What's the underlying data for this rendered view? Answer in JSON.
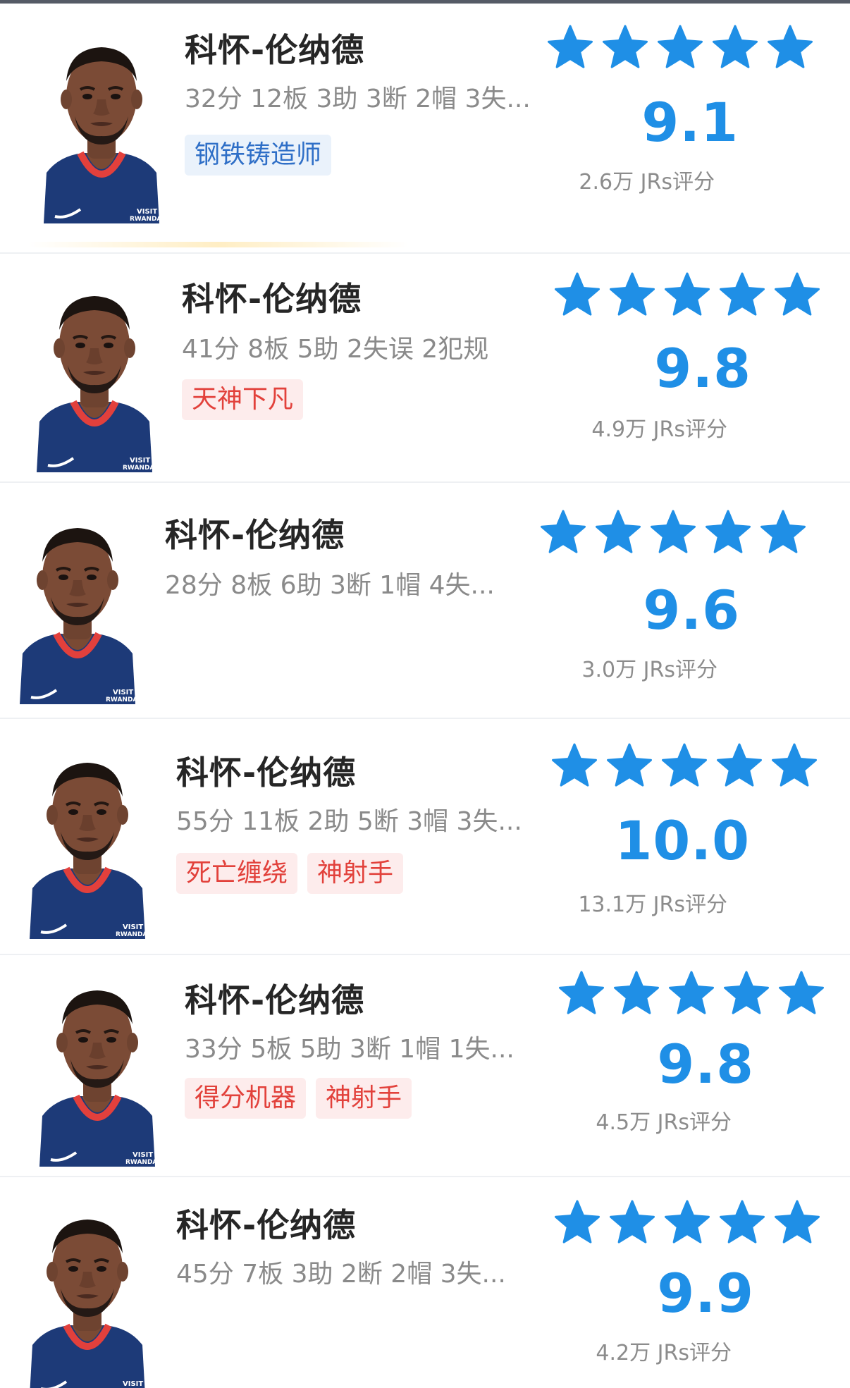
{
  "star_color": "#1f8fe6",
  "rating_count_suffix": "JRs评分",
  "items": [
    {
      "name": "科怀-伦纳德",
      "stats": "32分 12板 3助 3断 2帽 3失...",
      "tags": [
        {
          "text": "钢铁铸造师",
          "color": "blue"
        }
      ],
      "stars": 5,
      "score": "9.1",
      "rating_count": "2.6万 JRs评分"
    },
    {
      "name": "科怀-伦纳德",
      "stats": "41分 8板 5助 2失误 2犯规",
      "tags": [
        {
          "text": "天神下凡",
          "color": "red"
        }
      ],
      "stars": 5,
      "score": "9.8",
      "rating_count": "4.9万 JRs评分"
    },
    {
      "name": "科怀-伦纳德",
      "stats": "28分 8板 6助 3断 1帽 4失...",
      "tags": [],
      "stars": 5,
      "score": "9.6",
      "rating_count": "3.0万 JRs评分"
    },
    {
      "name": "科怀-伦纳德",
      "stats": "55分 11板 2助 5断 3帽 3失...",
      "tags": [
        {
          "text": "死亡缠绕",
          "color": "red"
        },
        {
          "text": "神射手",
          "color": "red"
        }
      ],
      "stars": 5,
      "score": "10.0",
      "rating_count": "13.1万 JRs评分"
    },
    {
      "name": "科怀-伦纳德",
      "stats": "33分 5板 5助 3断 1帽 1失...",
      "tags": [
        {
          "text": "得分机器",
          "color": "red"
        },
        {
          "text": "神射手",
          "color": "red"
        }
      ],
      "stars": 5,
      "score": "9.8",
      "rating_count": "4.5万 JRs评分"
    },
    {
      "name": "科怀-伦纳德",
      "stats": "45分 7板 3助 2断 2帽 3失...",
      "tags": [],
      "stars": 5,
      "score": "9.9",
      "rating_count": "4.2万 JRs评分"
    }
  ]
}
